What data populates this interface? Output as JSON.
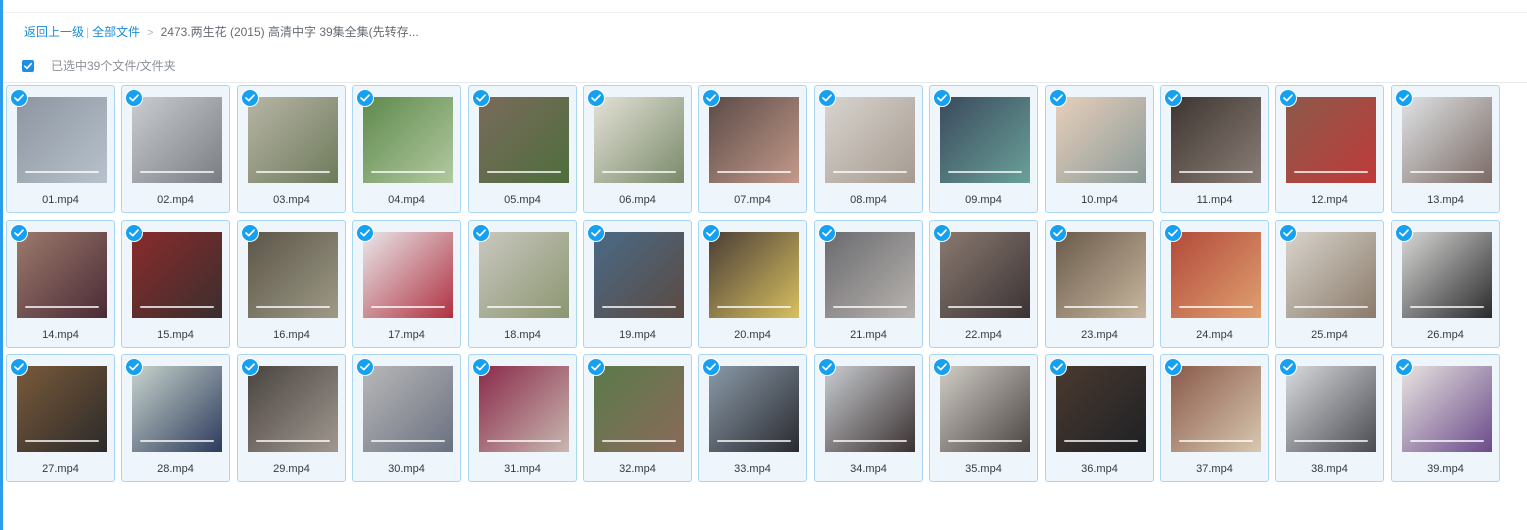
{
  "breadcrumb": {
    "back": "返回上一级",
    "all_files": "全部文件",
    "current": "2473.两生花 (2015) 高清中字 39集全集(先转存..."
  },
  "selection": {
    "label": "已选中39个文件/文件夹",
    "checked": true
  },
  "colors": {
    "accent": "#1a8cd8",
    "badge": "#16a0f0",
    "tile_border": "#a9d6f2",
    "tile_bg": "#eef5fb"
  },
  "files": [
    {
      "name": "01.mp4",
      "tone": [
        "#8d96a0",
        "#b8c2cc"
      ]
    },
    {
      "name": "02.mp4",
      "tone": [
        "#c9ccd0",
        "#7a7d82"
      ]
    },
    {
      "name": "03.mp4",
      "tone": [
        "#b7b5a6",
        "#6e7a5a"
      ]
    },
    {
      "name": "04.mp4",
      "tone": [
        "#5e8a4c",
        "#b3c9a1"
      ]
    },
    {
      "name": "05.mp4",
      "tone": [
        "#7a6a5c",
        "#4e6e3c"
      ]
    },
    {
      "name": "06.mp4",
      "tone": [
        "#e3e1d6",
        "#7a8a6a"
      ]
    },
    {
      "name": "07.mp4",
      "tone": [
        "#5b4b47",
        "#c49a8b"
      ]
    },
    {
      "name": "08.mp4",
      "tone": [
        "#d8d4ce",
        "#a59a90"
      ]
    },
    {
      "name": "09.mp4",
      "tone": [
        "#3a4a5c",
        "#6aa19a"
      ]
    },
    {
      "name": "10.mp4",
      "tone": [
        "#e8cfbb",
        "#8a9a98"
      ]
    },
    {
      "name": "11.mp4",
      "tone": [
        "#3f3530",
        "#8a7f78"
      ]
    },
    {
      "name": "12.mp4",
      "tone": [
        "#8b5a4a",
        "#c03a3a"
      ]
    },
    {
      "name": "13.mp4",
      "tone": [
        "#dfe2e5",
        "#7b6a64"
      ]
    },
    {
      "name": "14.mp4",
      "tone": [
        "#9c7a6c",
        "#4a2a36"
      ]
    },
    {
      "name": "15.mp4",
      "tone": [
        "#8a2b2b",
        "#3a2e2e"
      ]
    },
    {
      "name": "16.mp4",
      "tone": [
        "#5b5648",
        "#9e9a86"
      ]
    },
    {
      "name": "17.mp4",
      "tone": [
        "#e8e8ea",
        "#b03040"
      ]
    },
    {
      "name": "18.mp4",
      "tone": [
        "#c9c7bf",
        "#8b9670"
      ]
    },
    {
      "name": "19.mp4",
      "tone": [
        "#4a6a88",
        "#5b4a40"
      ]
    },
    {
      "name": "20.mp4",
      "tone": [
        "#4a3e36",
        "#d8c060"
      ]
    },
    {
      "name": "21.mp4",
      "tone": [
        "#6a6a6e",
        "#b8b4b0"
      ]
    },
    {
      "name": "22.mp4",
      "tone": [
        "#8a7a70",
        "#3a3234"
      ]
    },
    {
      "name": "23.mp4",
      "tone": [
        "#6a5a4a",
        "#c8b8a0"
      ]
    },
    {
      "name": "24.mp4",
      "tone": [
        "#b24a3a",
        "#e0a070"
      ]
    },
    {
      "name": "25.mp4",
      "tone": [
        "#d8d4cc",
        "#8a7a6a"
      ]
    },
    {
      "name": "26.mp4",
      "tone": [
        "#d8d8d6",
        "#2a2a2c"
      ]
    },
    {
      "name": "27.mp4",
      "tone": [
        "#7a5a3a",
        "#2a2a2a"
      ]
    },
    {
      "name": "28.mp4",
      "tone": [
        "#c8d4cc",
        "#2c3a5c"
      ]
    },
    {
      "name": "29.mp4",
      "tone": [
        "#4a4440",
        "#a09890"
      ]
    },
    {
      "name": "30.mp4",
      "tone": [
        "#b8b8b8",
        "#6a7080"
      ]
    },
    {
      "name": "31.mp4",
      "tone": [
        "#8a2a4a",
        "#c8b8b0"
      ]
    },
    {
      "name": "32.mp4",
      "tone": [
        "#5a7a4a",
        "#8a6a5a"
      ]
    },
    {
      "name": "33.mp4",
      "tone": [
        "#8a9aa8",
        "#2a2a30"
      ]
    },
    {
      "name": "34.mp4",
      "tone": [
        "#c8ccd0",
        "#3a3030"
      ]
    },
    {
      "name": "35.mp4",
      "tone": [
        "#d0ccc6",
        "#4a4440"
      ]
    },
    {
      "name": "36.mp4",
      "tone": [
        "#4a3a30",
        "#1e2024"
      ]
    },
    {
      "name": "37.mp4",
      "tone": [
        "#8a5a4a",
        "#d8c8b0"
      ]
    },
    {
      "name": "38.mp4",
      "tone": [
        "#d8dadc",
        "#4a4a52"
      ]
    },
    {
      "name": "39.mp4",
      "tone": [
        "#e8e4e0",
        "#6a4a8a"
      ]
    }
  ]
}
